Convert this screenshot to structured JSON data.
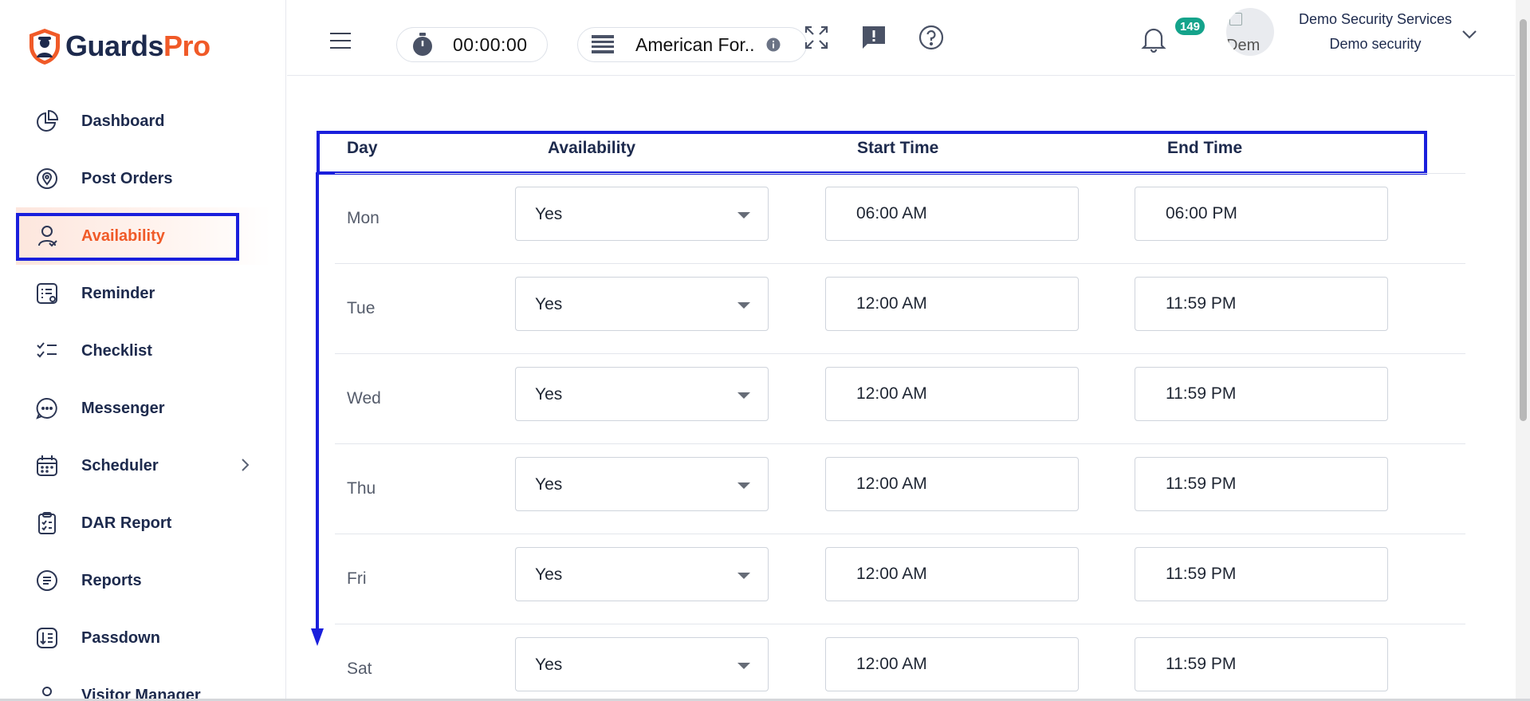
{
  "brand": {
    "name_part1": "Guards",
    "name_part2": "Pro",
    "accent": "#f05a28",
    "navy": "#1d2a4d"
  },
  "sidebar": {
    "items": [
      {
        "label": "Dashboard",
        "icon": "pie-chart-icon",
        "active": false
      },
      {
        "label": "Post Orders",
        "icon": "location-pin-icon",
        "active": false
      },
      {
        "label": "Availability",
        "icon": "user-check-icon",
        "active": true
      },
      {
        "label": "Reminder",
        "icon": "reminder-list-icon",
        "active": false
      },
      {
        "label": "Checklist",
        "icon": "checklist-icon",
        "active": false
      },
      {
        "label": "Messenger",
        "icon": "chat-bubble-icon",
        "active": false
      },
      {
        "label": "Scheduler",
        "icon": "calendar-icon",
        "active": false,
        "has_children": true
      },
      {
        "label": "DAR Report",
        "icon": "clipboard-icon",
        "active": false
      },
      {
        "label": "Reports",
        "icon": "document-icon",
        "active": false
      },
      {
        "label": "Passdown",
        "icon": "passdown-icon",
        "active": false
      },
      {
        "label": "Visitor Manager",
        "icon": "visitor-icon",
        "active": false
      }
    ]
  },
  "topbar": {
    "timer": "00:00:00",
    "site": "American For..",
    "notification_count": "149",
    "avatar_alt": "Dem",
    "company": "Demo Security Services",
    "role": "Demo security",
    "badge_color": "#14a38b"
  },
  "table": {
    "headers": {
      "day": "Day",
      "availability": "Availability",
      "start": "Start Time",
      "end": "End Time"
    },
    "rows": [
      {
        "day": "Mon",
        "availability": "Yes",
        "start": "06:00 AM",
        "end": "06:00 PM"
      },
      {
        "day": "Tue",
        "availability": "Yes",
        "start": "12:00 AM",
        "end": "11:59 PM"
      },
      {
        "day": "Wed",
        "availability": "Yes",
        "start": "12:00 AM",
        "end": "11:59 PM"
      },
      {
        "day": "Thu",
        "availability": "Yes",
        "start": "12:00 AM",
        "end": "11:59 PM"
      },
      {
        "day": "Fri",
        "availability": "Yes",
        "start": "12:00 AM",
        "end": "11:59 PM"
      },
      {
        "day": "Sat",
        "availability": "Yes",
        "start": "12:00 AM",
        "end": "11:59 PM"
      }
    ]
  },
  "annotation_color": "#1a1fdc"
}
